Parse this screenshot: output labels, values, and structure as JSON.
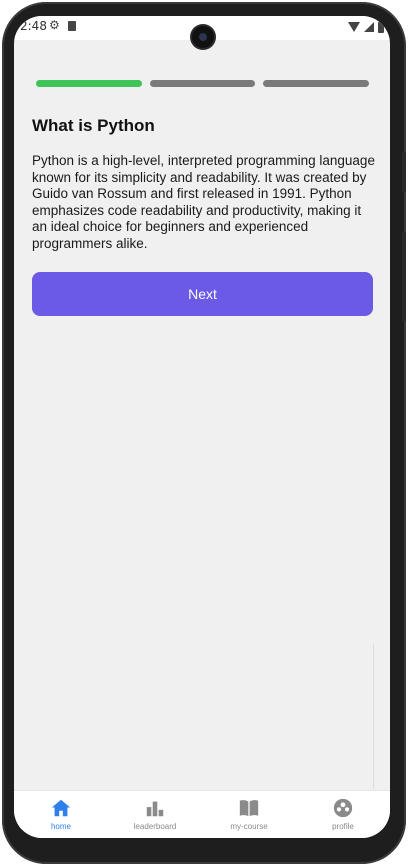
{
  "status_bar": {
    "time": "2:48"
  },
  "progress": {
    "segments": [
      {
        "state": "completed",
        "color": "#3fc45a"
      },
      {
        "state": "pending",
        "color": "#7a7a7a"
      },
      {
        "state": "pending",
        "color": "#7a7a7a"
      }
    ]
  },
  "lesson": {
    "title": "What is Python",
    "body": "Python is a high-level, interpreted programming language known for its simplicity and readability. It was created by Guido van Rossum and first released in 1991. Python emphasizes code readability and productivity, making it an ideal choice for beginners and experienced programmers alike."
  },
  "actions": {
    "next_label": "Next",
    "next_color": "#6a5ae6"
  },
  "bottom_nav": {
    "active_color": "#2f80ed",
    "inactive_color": "#8a8a8a",
    "items": [
      {
        "label": "home",
        "icon": "home-icon",
        "active": true
      },
      {
        "label": "leaderboard",
        "icon": "leaderboard-icon",
        "active": false
      },
      {
        "label": "my-course",
        "icon": "book-icon",
        "active": false
      },
      {
        "label": "profile",
        "icon": "profile-icon",
        "active": false
      }
    ]
  }
}
